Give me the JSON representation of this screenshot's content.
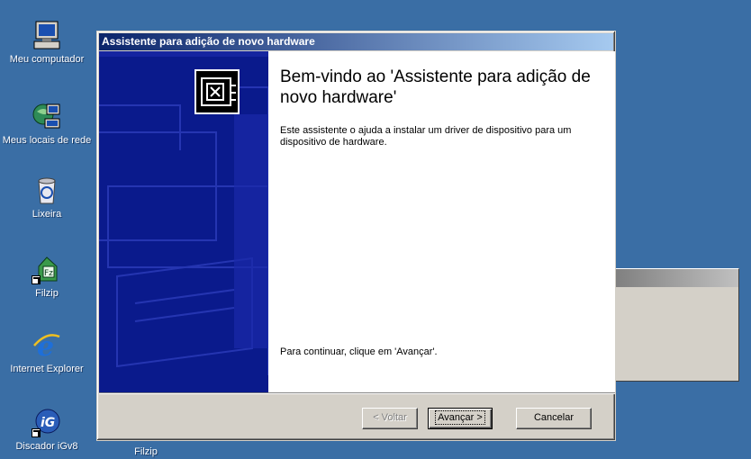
{
  "desktop": {
    "icons": [
      {
        "label": "Meu computador",
        "icon": "my-computer-icon"
      },
      {
        "label": "Meus locais de rede",
        "icon": "network-places-icon"
      },
      {
        "label": "Lixeira",
        "icon": "recycle-bin-icon"
      },
      {
        "label": "Filzip",
        "icon": "filzip-icon"
      },
      {
        "label": "Internet Explorer",
        "icon": "internet-explorer-icon"
      },
      {
        "label": "Discador iGv8",
        "icon": "igv8-dialer-icon"
      },
      {
        "label": "Filzip",
        "icon": "filzip-icon"
      }
    ],
    "background_color": "#3a6ea5"
  },
  "wizard": {
    "title": "Assistente para adição de novo hardware",
    "heading": "Bem-vindo ao 'Assistente para adição de novo hardware'",
    "description": "Este assistente o ajuda a instalar um driver de dispositivo para um dispositivo de hardware.",
    "continue_text": "Para continuar, clique em 'Avançar'.",
    "buttons": {
      "back": "< Voltar",
      "next": "Avançar >",
      "cancel": "Cancelar"
    },
    "title_color": "#0a246a",
    "side_art_color": "#0a1a8c"
  }
}
